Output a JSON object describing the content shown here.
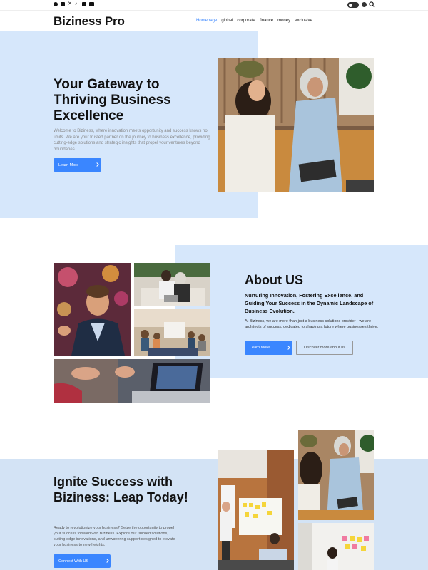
{
  "topbar": {
    "social_icons": [
      "facebook-icon",
      "instagram-icon",
      "x-icon",
      "tiktok-icon",
      "linkedin-icon",
      "youtube-icon"
    ]
  },
  "header": {
    "logo": "Biziness Pro",
    "nav": [
      {
        "label": "Homepage",
        "active": true
      },
      {
        "label": "global",
        "active": false
      },
      {
        "label": "corporate",
        "active": false
      },
      {
        "label": "finance",
        "active": false
      },
      {
        "label": "money",
        "active": false
      },
      {
        "label": "exclusive",
        "active": false
      }
    ]
  },
  "hero": {
    "title": "Your Gateway to Thriving Business Excellence",
    "text": "Welcome to Biziness, where innovation meets opportunity and success knows no limits. We are your trusted partner on the journey to business excellence, providing cutting-edge solutions and strategic insights that propel your ventures beyond boundaries.",
    "button": "Learn More"
  },
  "about": {
    "title": "About US",
    "subtitle": "Nurturing Innovation, Fostering Excellence, and Guiding Your Success in the Dynamic Landscape of Business Evolution.",
    "text": "At Biziness, we are more than just a business solutions provider - we are architects of success, dedicated to shaping a future where businesses thrive.",
    "button_primary": "Learn More",
    "button_secondary": "Discover more about us"
  },
  "ignite": {
    "title": "Ignite Success with Biziness: Leap Today!",
    "text": "Ready to revolutionize your business? Seize the opportunity to propel your success forward with Biziness. Explore our tailored solutions, cutting-edge innovations, and unwavering support designed to elevate your business to new heights.",
    "button": "Connect With US"
  },
  "colors": {
    "accent": "#3a86ff",
    "section_bg": "#d6e7fb"
  }
}
